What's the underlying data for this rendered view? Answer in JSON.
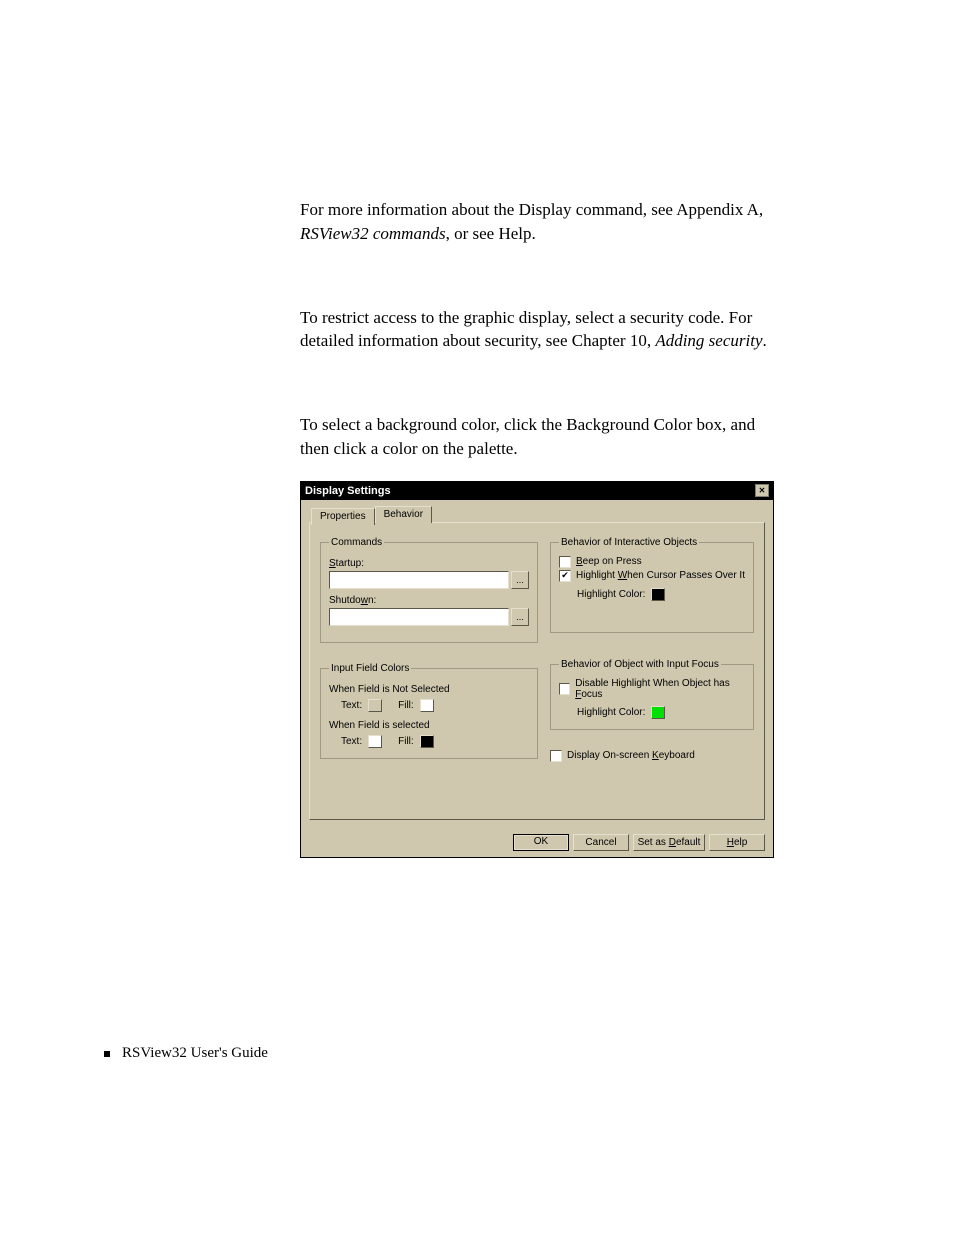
{
  "paragraphs": {
    "p1a": "For more information about the Display command, see Appendix A, ",
    "p1b": "RSView32 commands",
    "p1c": ", or see Help.",
    "p2a": "To restrict access to the graphic display, select a security code. For detailed information about security, see Chapter 10, ",
    "p2b": "Adding security",
    "p2c": ".",
    "p3": "To select a background color, click the Background Color box, and then click a color on the palette."
  },
  "dialog": {
    "title": "Display Settings",
    "tabs": {
      "properties": "Properties",
      "behavior": "Behavior"
    },
    "commands": {
      "legend": "Commands",
      "startup_u": "S",
      "startup_rest": "tartup:",
      "shutdown_pre": "Shutdo",
      "shutdown_u": "w",
      "shutdown_post": "n:",
      "browse": "..."
    },
    "input_colors": {
      "legend": "Input Field Colors",
      "not_selected": "When Field is Not Selected",
      "selected": "When Field is selected",
      "text": "Text:",
      "fill": "Fill:",
      "swatches": {
        "ns_text": "#000000",
        "ns_fill": "#ffffff",
        "s_text": "#ffffff",
        "s_fill": "#000000"
      }
    },
    "interactive": {
      "legend": "Behavior of Interactive Objects",
      "beep_u": "B",
      "beep_rest": "eep on Press",
      "hw_pre": "Highlight ",
      "hw_u": "W",
      "hw_post": "hen Cursor Passes Over It",
      "hl_label": "Highlight Color:",
      "hl_color": "#000000",
      "check_on": "✔"
    },
    "focus": {
      "legend": "Behavior of Object with Input Focus",
      "dh_pre": "Disable Highlight When Object has ",
      "dh_u": "F",
      "dh_post": "ocus",
      "hl_label": "Highlight Color:",
      "hl_color": "#00e000"
    },
    "keyboard": {
      "pre": "Display On-screen ",
      "u": "K",
      "post": "eyboard"
    },
    "buttons": {
      "ok": "OK",
      "cancel": "Cancel",
      "default_pre": "Set as ",
      "default_u": "D",
      "default_post": "efault",
      "help_u": "H",
      "help_rest": "elp"
    },
    "close_glyph": "✕"
  },
  "footer": "RSView32  User's Guide"
}
